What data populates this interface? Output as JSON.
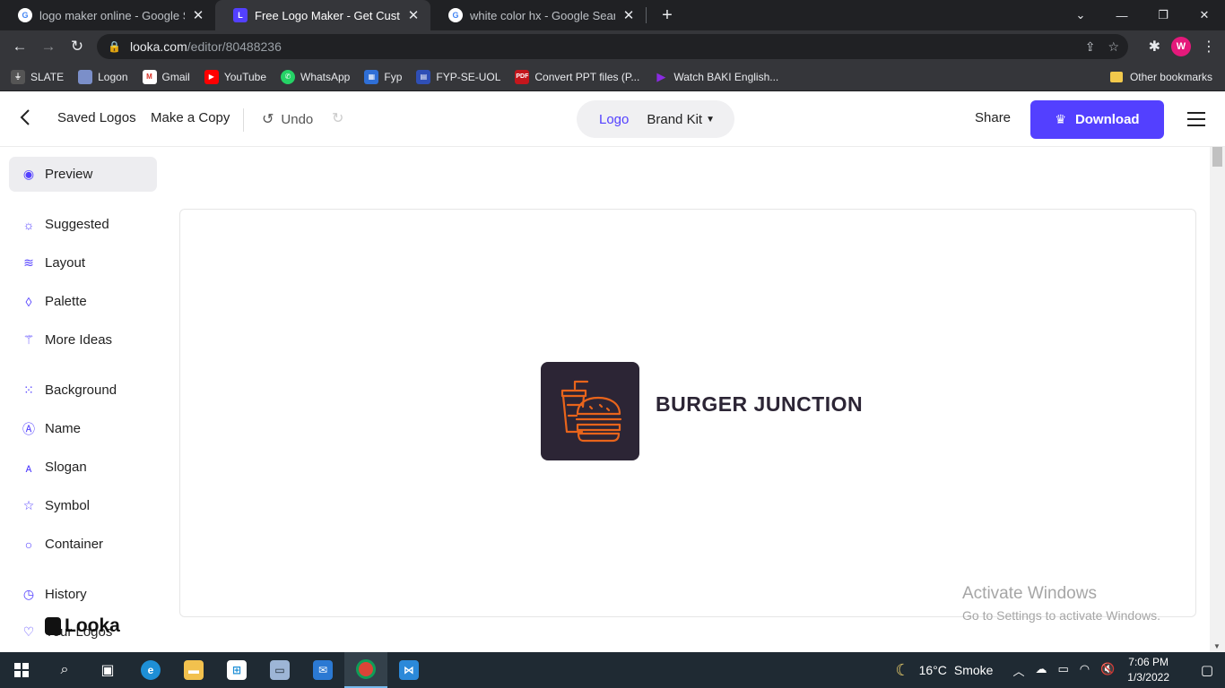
{
  "browser": {
    "tabs": [
      {
        "title": "logo maker online - Google Search",
        "favicon": "google-icon",
        "active": false
      },
      {
        "title": "Free Logo Maker - Get Custom Lo",
        "favicon": "looka-icon",
        "active": true
      },
      {
        "title": "white color hx - Google Search",
        "favicon": "google-icon",
        "active": false
      }
    ],
    "url_host": "looka.com",
    "url_path": "/editor/80488236",
    "profile_initial": "W",
    "bookmarks": [
      {
        "label": "SLATE",
        "icon": "slate-icon"
      },
      {
        "label": "Logon",
        "icon": "logon-icon"
      },
      {
        "label": "Gmail",
        "icon": "gmail-icon"
      },
      {
        "label": "YouTube",
        "icon": "youtube-icon"
      },
      {
        "label": "WhatsApp",
        "icon": "whatsapp-icon"
      },
      {
        "label": "Fyp",
        "icon": "fyp-icon"
      },
      {
        "label": "FYP-SE-UOL",
        "icon": "fyp-se-uol-icon"
      },
      {
        "label": "Convert PPT files (P...",
        "icon": "pdf-icon"
      },
      {
        "label": "Watch BAKI English...",
        "icon": "play-icon"
      }
    ],
    "other_bookmarks": "Other bookmarks"
  },
  "header": {
    "saved_logos": "Saved Logos",
    "make_copy": "Make a Copy",
    "undo": "Undo",
    "toggle_logo": "Logo",
    "toggle_brand_kit": "Brand Kit",
    "share": "Share",
    "download": "Download",
    "accent_color": "#5340ff"
  },
  "sidebar": {
    "items": [
      {
        "label": "Preview",
        "icon": "eye-icon",
        "active": true
      },
      {
        "label": "Suggested",
        "icon": "lightbulb-icon"
      },
      {
        "label": "Layout",
        "icon": "layers-icon"
      },
      {
        "label": "Palette",
        "icon": "droplet-icon"
      },
      {
        "label": "More Ideas",
        "icon": "magic-wand-icon"
      },
      {
        "label": "Background",
        "icon": "background-icon"
      },
      {
        "label": "Name",
        "icon": "text-box-icon"
      },
      {
        "label": "Slogan",
        "icon": "font-icon"
      },
      {
        "label": "Symbol",
        "icon": "star-icon"
      },
      {
        "label": "Container",
        "icon": "circle-icon"
      },
      {
        "label": "History",
        "icon": "history-icon"
      },
      {
        "label": "Your Logos",
        "icon": "heart-icon"
      }
    ],
    "brand": "Looka"
  },
  "canvas": {
    "logo_name": "BURGER JUNCTION",
    "logo_bg_color": "#2c2535",
    "logo_symbol_color": "#e8641b",
    "watermark_title": "Activate Windows",
    "watermark_sub": "Go to Settings to activate Windows."
  },
  "taskbar": {
    "temperature": "16°C",
    "weather": "Smoke",
    "time": "7:06 PM",
    "date": "1/3/2022"
  }
}
